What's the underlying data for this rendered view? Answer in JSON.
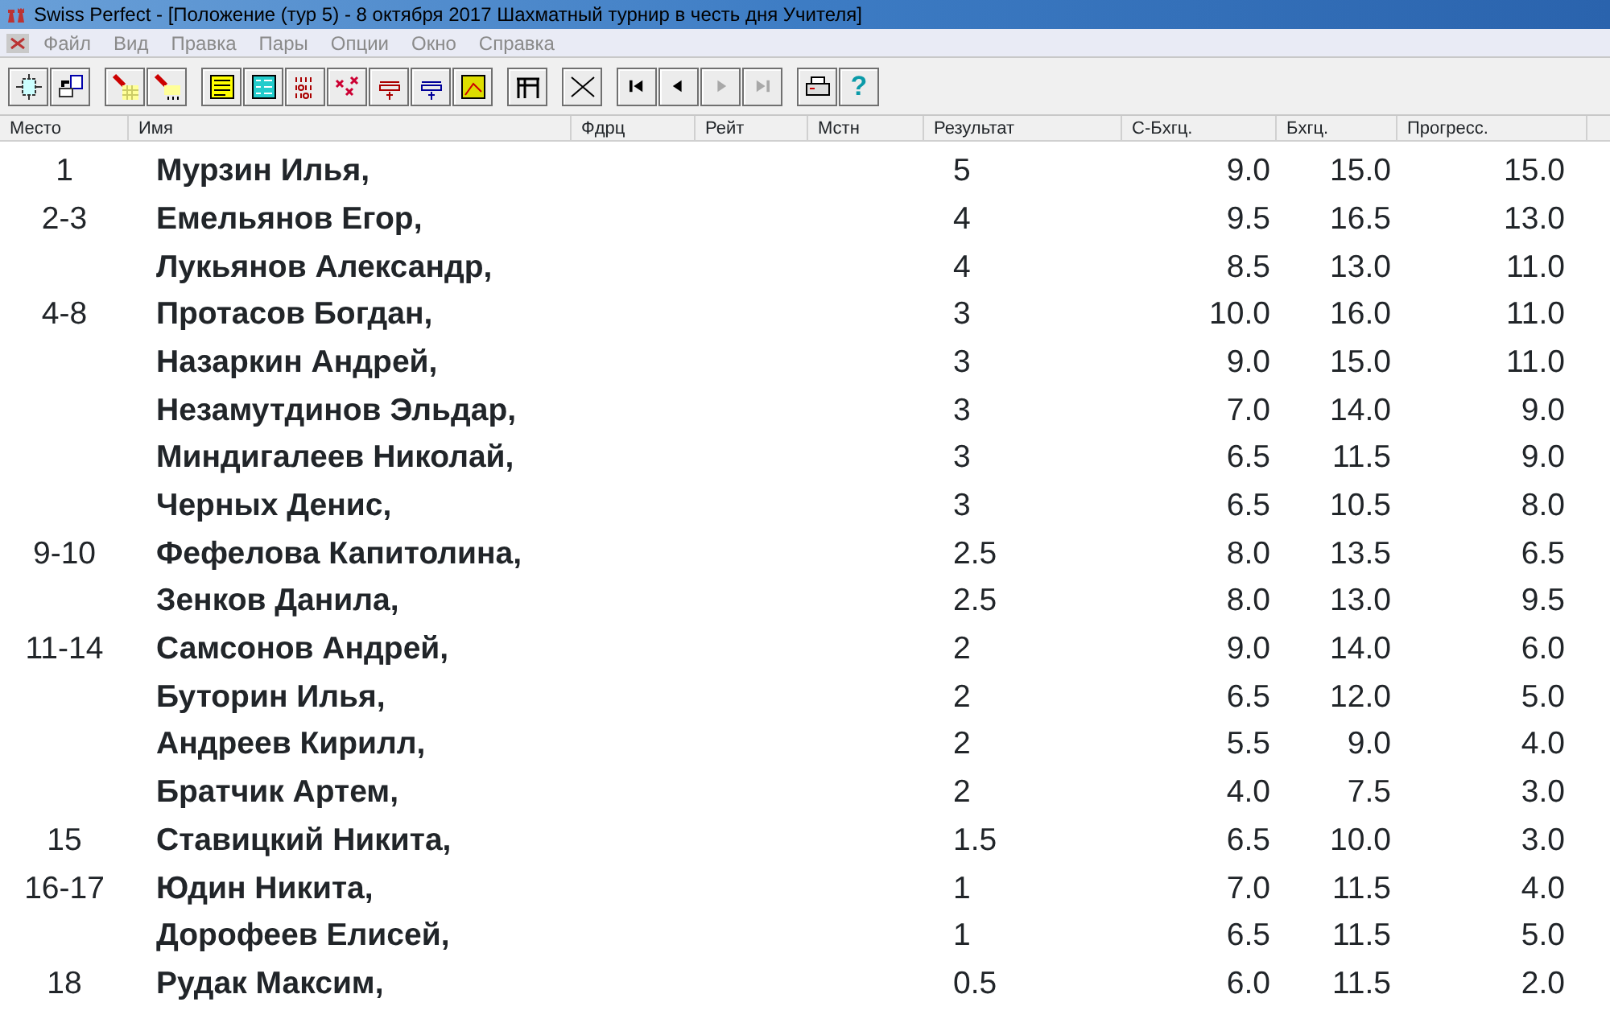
{
  "window": {
    "title": "Swiss Perfect - [Положение  (тур 5) - 8 октября 2017 Шахматный турнир в честь дня Учителя]"
  },
  "menu": [
    "Файл",
    "Вид",
    "Правка",
    "Пары",
    "Опции",
    "Окно",
    "Справка"
  ],
  "toolbar": {
    "navigation": [
      {
        "disabled": false
      },
      {
        "disabled": false
      },
      {
        "disabled": true
      },
      {
        "disabled": true
      }
    ],
    "help": "?"
  },
  "table": {
    "columns": [
      "Место",
      "Имя",
      "Фдрц",
      "Рейт",
      "Мстн",
      "Результат",
      "С-Бхгц.",
      "Бхгц.",
      "Прогресс."
    ],
    "rows": [
      {
        "place": "1",
        "name": "Мурзин Илья,",
        "result": "5",
        "sbh": "9.0",
        "bh": "15.0",
        "progress": "15.0"
      },
      {
        "place": "2-3",
        "name": "Емельянов Егор,",
        "result": "4",
        "sbh": "9.5",
        "bh": "16.5",
        "progress": "13.0"
      },
      {
        "place": "",
        "name": "Лукьянов Александр,",
        "result": "4",
        "sbh": "8.5",
        "bh": "13.0",
        "progress": "11.0"
      },
      {
        "place": "4-8",
        "name": "Протасов Богдан,",
        "result": "3",
        "sbh": "10.0",
        "bh": "16.0",
        "progress": "11.0"
      },
      {
        "place": "",
        "name": "Назаркин Андрей,",
        "result": "3",
        "sbh": "9.0",
        "bh": "15.0",
        "progress": "11.0"
      },
      {
        "place": "",
        "name": "Незамутдинов Эльдар,",
        "result": "3",
        "sbh": "7.0",
        "bh": "14.0",
        "progress": "9.0"
      },
      {
        "place": "",
        "name": "Миндигалеев Николай,",
        "result": "3",
        "sbh": "6.5",
        "bh": "11.5",
        "progress": "9.0"
      },
      {
        "place": "",
        "name": "Черных Денис,",
        "result": "3",
        "sbh": "6.5",
        "bh": "10.5",
        "progress": "8.0"
      },
      {
        "place": "9-10",
        "name": "Фефелова Капитолина,",
        "result": "2.5",
        "sbh": "8.0",
        "bh": "13.5",
        "progress": "6.5"
      },
      {
        "place": "",
        "name": "Зенков Данила,",
        "result": "2.5",
        "sbh": "8.0",
        "bh": "13.0",
        "progress": "9.5"
      },
      {
        "place": "11-14",
        "name": "Самсонов Андрей,",
        "result": "2",
        "sbh": "9.0",
        "bh": "14.0",
        "progress": "6.0"
      },
      {
        "place": "",
        "name": "Буторин Илья,",
        "result": "2",
        "sbh": "6.5",
        "bh": "12.0",
        "progress": "5.0"
      },
      {
        "place": "",
        "name": "Андреев Кирилл,",
        "result": "2",
        "sbh": "5.5",
        "bh": "9.0",
        "progress": "4.0"
      },
      {
        "place": "",
        "name": "Братчик Артем,",
        "result": "2",
        "sbh": "4.0",
        "bh": "7.5",
        "progress": "3.0"
      },
      {
        "place": "15",
        "name": "Ставицкий Никита,",
        "result": "1.5",
        "sbh": "6.5",
        "bh": "10.0",
        "progress": "3.0"
      },
      {
        "place": "16-17",
        "name": "Юдин Никита,",
        "result": "1",
        "sbh": "7.0",
        "bh": "11.5",
        "progress": "4.0"
      },
      {
        "place": "",
        "name": "Дорофеев Елисей,",
        "result": "1",
        "sbh": "6.5",
        "bh": "11.5",
        "progress": "5.0"
      },
      {
        "place": "18",
        "name": "Рудак Максим,",
        "result": "0.5",
        "sbh": "6.0",
        "bh": "11.5",
        "progress": "2.0"
      }
    ]
  }
}
